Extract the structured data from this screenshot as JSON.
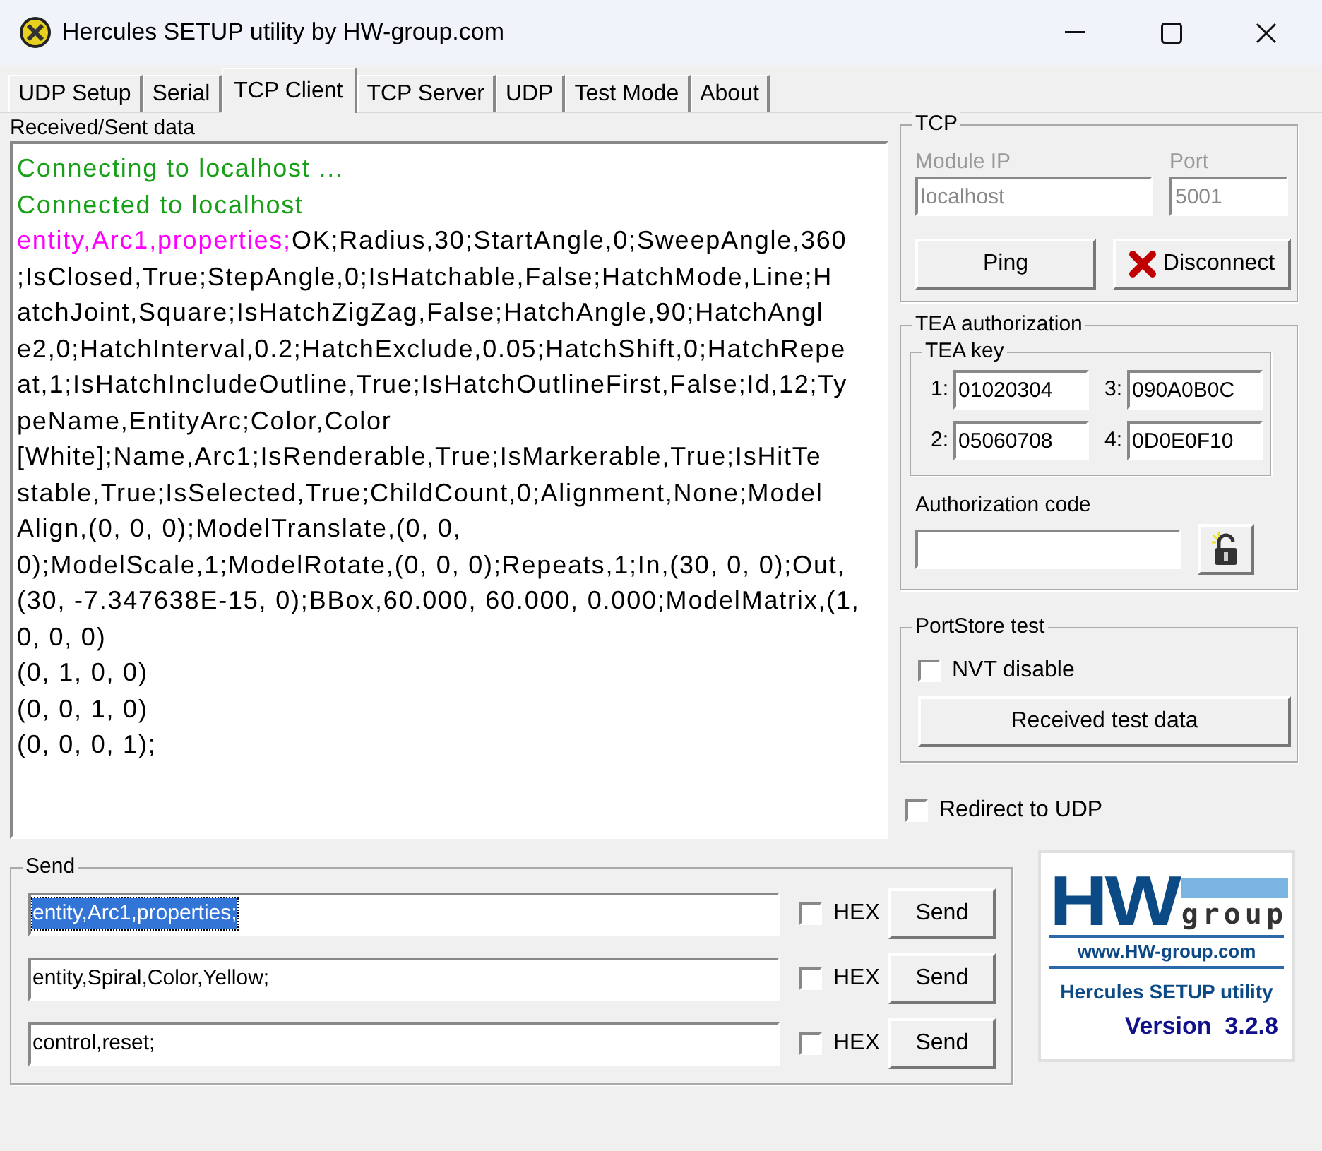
{
  "window": {
    "title": "Hercules SETUP utility by HW-group.com"
  },
  "tabs": [
    {
      "label": "UDP Setup",
      "selected": false
    },
    {
      "label": "Serial",
      "selected": false
    },
    {
      "label": "TCP Client",
      "selected": true
    },
    {
      "label": "TCP Server",
      "selected": false
    },
    {
      "label": "UDP",
      "selected": false
    },
    {
      "label": "Test Mode",
      "selected": false
    },
    {
      "label": "About",
      "selected": false
    }
  ],
  "received": {
    "label": "Received/Sent data",
    "lines": [
      [
        {
          "kind": "status",
          "text": "Connecting to localhost ..."
        }
      ],
      [
        {
          "kind": "status",
          "text": "Connected to localhost"
        }
      ],
      [
        {
          "kind": "sent",
          "text": "entity,Arc1,properties;"
        },
        {
          "kind": "received",
          "text": "OK;Radius,30;StartAngle,0;SweepAngle,360"
        }
      ],
      [
        {
          "kind": "received",
          "text": ";IsClosed,True;StepAngle,0;IsHatchable,False;HatchMode,Line;H"
        }
      ],
      [
        {
          "kind": "received",
          "text": "atchJoint,Square;IsHatchZigZag,False;HatchAngle,90;HatchAngl"
        }
      ],
      [
        {
          "kind": "received",
          "text": "e2,0;HatchInterval,0.2;HatchExclude,0.05;HatchShift,0;HatchRepe"
        }
      ],
      [
        {
          "kind": "received",
          "text": "at,1;IsHatchIncludeOutline,True;IsHatchOutlineFirst,False;Id,12;Ty"
        }
      ],
      [
        {
          "kind": "received",
          "text": "peName,EntityArc;Color,Color"
        }
      ],
      [
        {
          "kind": "received",
          "text": "[White];Name,Arc1;IsRenderable,True;IsMarkerable,True;IsHitTe"
        }
      ],
      [
        {
          "kind": "received",
          "text": "stable,True;IsSelected,True;ChildCount,0;Alignment,None;Model"
        }
      ],
      [
        {
          "kind": "received",
          "text": "Align,(0, 0, 0);ModelTranslate,(0, 0,"
        }
      ],
      [
        {
          "kind": "received",
          "text": "0);ModelScale,1;ModelRotate,(0, 0, 0);Repeats,1;In,(30, 0, 0);Out,"
        }
      ],
      [
        {
          "kind": "received",
          "text": "(30, -7.347638E-15, 0);BBox,60.000, 60.000, 0.000;ModelMatrix,(1,"
        }
      ],
      [
        {
          "kind": "received",
          "text": "0, 0, 0)"
        }
      ],
      [
        {
          "kind": "received",
          "text": "(0, 1, 0, 0)"
        }
      ],
      [
        {
          "kind": "received",
          "text": "(0, 0, 1, 0)"
        }
      ],
      [
        {
          "kind": "received",
          "text": "(0, 0, 0, 1);"
        }
      ]
    ]
  },
  "tcp": {
    "title": "TCP",
    "module_ip": {
      "label": "Module IP",
      "value": "localhost",
      "disabled": true
    },
    "port": {
      "label": "Port",
      "value": "5001",
      "disabled": true
    },
    "ping": "Ping",
    "disconnect": "Disconnect"
  },
  "tea": {
    "title": "TEA authorization",
    "key_title": "TEA key",
    "keys": [
      {
        "label": "1:",
        "value": "01020304"
      },
      {
        "label": "3:",
        "value": "090A0B0C"
      },
      {
        "label": "2:",
        "value": "05060708"
      },
      {
        "label": "4:",
        "value": "0D0E0F10"
      }
    ],
    "auth_label": "Authorization code"
  },
  "portstore": {
    "title": "PortStore test",
    "nvt": {
      "label": "NVT disable",
      "checked": false
    },
    "button": "Received test data"
  },
  "redirect": {
    "label": "Redirect to UDP",
    "checked": false
  },
  "send": {
    "title": "Send",
    "rows": [
      {
        "value": "entity,Arc1,properties;",
        "text_selected": true,
        "hex": {
          "label": "HEX",
          "checked": false
        },
        "button": "Send"
      },
      {
        "value": "entity,Spiral,Color,Yellow;",
        "text_selected": false,
        "hex": {
          "label": "HEX",
          "checked": false
        },
        "button": "Send"
      },
      {
        "value": "control,reset;",
        "text_selected": false,
        "hex": {
          "label": "HEX",
          "checked": false
        },
        "button": "Send"
      }
    ]
  },
  "logo": {
    "mark": "HW",
    "word": "group",
    "url": "www.HW-group.com",
    "product": "Hercules SETUP utility",
    "version": "Version  3.2.8"
  }
}
